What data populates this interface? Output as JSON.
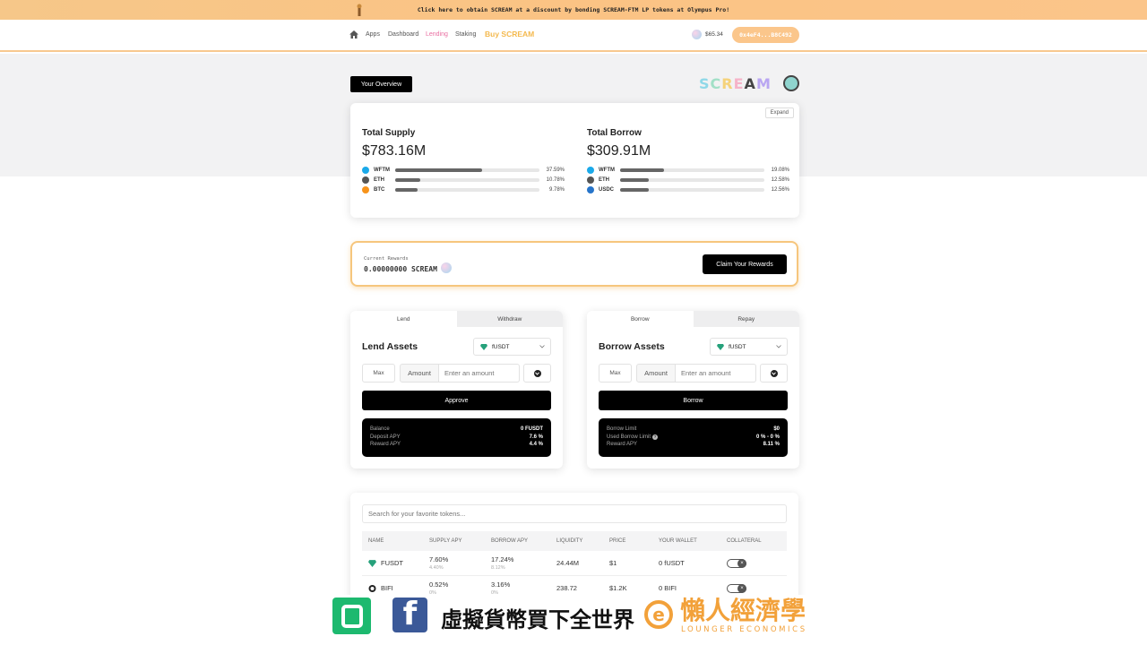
{
  "banner": {
    "text": "Click here to obtain SCREAM at a discount by bonding SCREAM-FTM LP tokens at Olympus Pro!"
  },
  "nav": {
    "links": [
      "Apps",
      "Dashboard",
      "Lending",
      "Staking"
    ],
    "active": "Lending",
    "buy_label": "Buy SCREAM",
    "scream_price": "$65.34",
    "wallet": "0x4eF4...B8C492"
  },
  "overview": {
    "button_label": "Your Overview",
    "logo_letters": [
      "S",
      "C",
      "R",
      "E",
      "A",
      "M"
    ],
    "expand_label": "Expand",
    "supply": {
      "title": "Total Supply",
      "value": "$783.16M",
      "rows": [
        {
          "symbol": "WFTM",
          "pct": "37.59%",
          "fraction": 0.3759,
          "color": "#1ba9e9"
        },
        {
          "symbol": "ETH",
          "pct": "10.78%",
          "fraction": 0.1078,
          "color": "#555555"
        },
        {
          "symbol": "BTC",
          "pct": "9.78%",
          "fraction": 0.0978,
          "color": "#f7931a"
        }
      ]
    },
    "borrow": {
      "title": "Total Borrow",
      "value": "$309.91M",
      "rows": [
        {
          "symbol": "WFTM",
          "pct": "19.08%",
          "fraction": 0.1908,
          "color": "#1ba9e9"
        },
        {
          "symbol": "ETH",
          "pct": "12.58%",
          "fraction": 0.1258,
          "color": "#555555"
        },
        {
          "symbol": "USDC",
          "pct": "12.56%",
          "fraction": 0.1256,
          "color": "#2775ca"
        }
      ]
    }
  },
  "rewards": {
    "label": "Current Rewards",
    "value": "0.00000000 SCREAM",
    "claim_label": "Claim Your Rewards"
  },
  "lend_panel": {
    "tabs": [
      "Lend",
      "Withdraw"
    ],
    "title": "Lend Assets",
    "asset": "fUSDT",
    "max_label": "Max",
    "amount_label": "Amount",
    "amount_placeholder": "Enter an amount",
    "action_label": "Approve",
    "info": [
      {
        "k": "Balance",
        "v": "0 FUSDT"
      },
      {
        "k": "Deposit APY",
        "v": "7.6 %"
      },
      {
        "k": "Reward APY",
        "v": "4.4 %"
      }
    ]
  },
  "borrow_panel": {
    "tabs": [
      "Borrow",
      "Repay"
    ],
    "title": "Borrow Assets",
    "asset": "fUSDT",
    "max_label": "Max",
    "amount_label": "Amount",
    "amount_placeholder": "Enter an amount",
    "action_label": "Borrow",
    "info": [
      {
        "k": "Borrow Limit",
        "v": "$0"
      },
      {
        "k": "Used Borrow Limit",
        "v": "0 % - 0 %"
      },
      {
        "k": "Reward APY",
        "v": "8.11 %"
      }
    ]
  },
  "table": {
    "search_placeholder": "Search for your favorite tokens...",
    "headers": [
      "NAME",
      "SUPPLY APY",
      "BORROW APY",
      "LIQUIDITY",
      "PRICE",
      "YOUR WALLET",
      "COLLATERAL"
    ],
    "rows": [
      {
        "name": "FUSDT",
        "supply": "7.60%",
        "supply_sub": "4.40%",
        "borrow": "17.24%",
        "borrow_sub": "8.12%",
        "liquidity": "24.44M",
        "price": "$1",
        "wallet": "0 fUSDT"
      },
      {
        "name": "BIFI",
        "supply": "0.52%",
        "supply_sub": "0%",
        "borrow": "3.16%",
        "borrow_sub": "0%",
        "liquidity": "238.72",
        "price": "$1.2K",
        "wallet": "0 BIFI"
      }
    ]
  },
  "footer": {
    "slogan": "虛擬貨幣買下全世界",
    "brand": "懶人經濟學",
    "brand_sub": "LOUNGER ECONOMICS"
  }
}
